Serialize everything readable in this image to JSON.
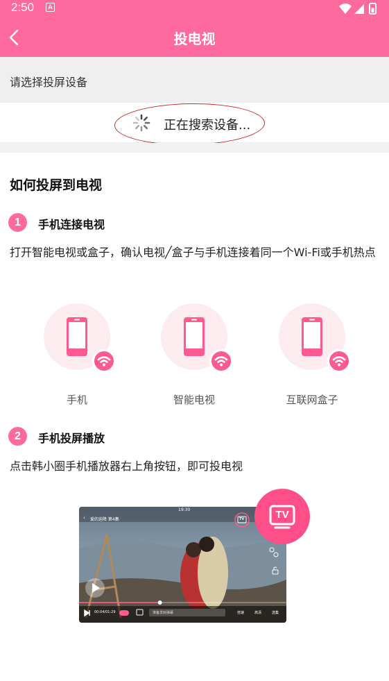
{
  "status_bar": {
    "time": "2:50",
    "notification_icon": "A"
  },
  "app_bar": {
    "title": "投电视",
    "back_icon": "chevron-left-icon"
  },
  "prompt": "请选择投屏设备",
  "search_status": "正在搜索设备...",
  "section_title": "如何投屏到电视",
  "steps": [
    {
      "number": "1",
      "title": "手机连接电视",
      "description": "打开智能电视或盒子，确认电视╱盒子与手机连接着同一个Wi-Fi或手机热点"
    },
    {
      "number": "2",
      "title": "手机投屏播放",
      "description": "点击韩小圈手机播放器右上角按钮，即可投电视"
    }
  ],
  "devices": [
    {
      "label": "手机",
      "icon": "phone-icon"
    },
    {
      "label": "智能电视",
      "icon": "phone-icon"
    },
    {
      "label": "互联网盒子",
      "icon": "phone-icon"
    }
  ],
  "video_preview": {
    "episode_title": "爱的迫降 第4集",
    "clock": "19:30",
    "time_readout": "00:04/01:29",
    "danmaku_placeholder": "准备发射弹幕",
    "speed_label": "倍速",
    "quality_label": "高清",
    "episodes_label": "选集",
    "progress": 0.39,
    "tv_badge": "TV"
  },
  "colors": {
    "accent": "#ff6a9e",
    "annotation_ring": "#c62828"
  }
}
